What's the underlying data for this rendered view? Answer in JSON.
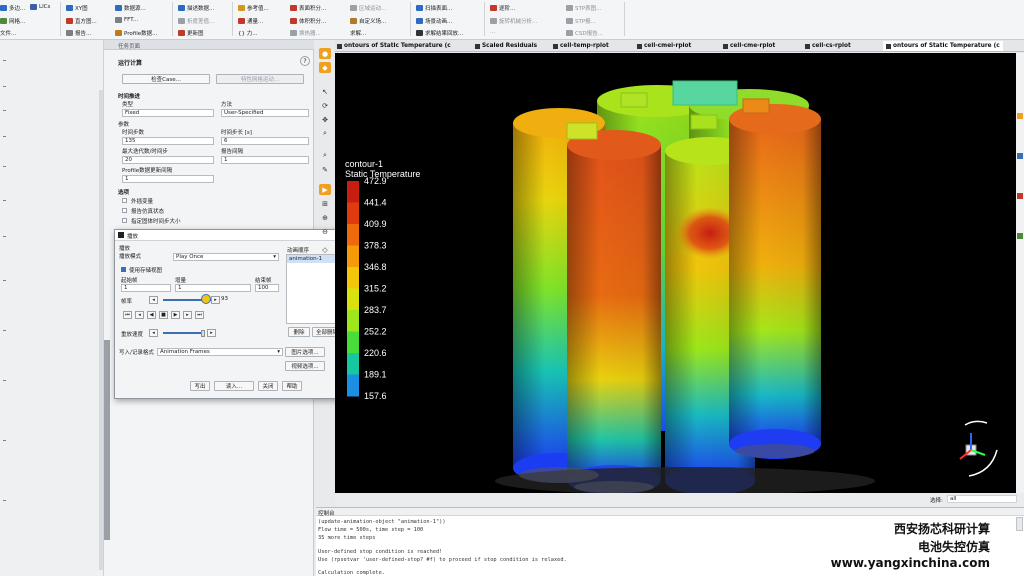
{
  "ribbon": {
    "items": [
      {
        "label": "多边...",
        "color": "#2d6cc1"
      },
      {
        "label": "网格...",
        "color": "#4f8a3a"
      },
      {
        "label": "文件...",
        "color": "#7a7f86"
      },
      {
        "label": "LICs",
        "color": "#3a5fa8"
      },
      {
        "label": "XY图",
        "color": "#2d6cc1"
      },
      {
        "label": "直方图...",
        "color": "#c0392b"
      },
      {
        "label": "报告...",
        "color": "#7a7f86"
      },
      {
        "label": "数据源...",
        "color": "#2d6cc1"
      },
      {
        "label": "FFT...",
        "color": "#7a7f86"
      },
      {
        "label": "Profile数据...",
        "color": "#c27a18"
      },
      {
        "label": "描述数据...",
        "color": "#2d6cc1"
      },
      {
        "label": "折度差值...",
        "color": "#9aa0a6"
      },
      {
        "label": "更新图",
        "color": "#c0392b"
      },
      {
        "label": "参考值...",
        "color": "#d19a1a"
      },
      {
        "label": "通量...",
        "color": "#c0392b"
      },
      {
        "label": "{} 力...",
        "color": "#2d6cc1"
      },
      {
        "label": "表面积分...",
        "color": "#c0392b"
      },
      {
        "label": "体积积分...",
        "color": "#c0392b"
      },
      {
        "label": "换热器...",
        "color": "#9aa0a6"
      },
      {
        "label": "区域运动...",
        "color": "#9aa0a6"
      },
      {
        "label": "自定义场...",
        "color": "#b07a2a"
      },
      {
        "label": "求解...",
        "color": "#7a7f86"
      },
      {
        "label": "扫描表面...",
        "color": "#2d6cc1"
      },
      {
        "label": "场景动画...",
        "color": "#2d6cc1"
      },
      {
        "label": "求解结果回放...",
        "color": "#333"
      },
      {
        "label": "逐阶...",
        "color": "#c0392b"
      },
      {
        "label": "旋转机械分析...",
        "color": "#9aa0a6"
      },
      {
        "label": "...",
        "color": "#9aa0a6"
      },
      {
        "label": "STP表图...",
        "color": "#9aa0a6"
      },
      {
        "label": "STP报...",
        "color": "#9aa0a6"
      },
      {
        "label": "CSD报告...",
        "color": "#9aa0a6"
      }
    ]
  },
  "task_panel": {
    "header": "任务页面",
    "title": "运行计算",
    "check_case": "检查Case...",
    "preview_mesh": "特性网格运动...",
    "time_advance": "时间推进",
    "type_label": "类型",
    "type_value": "Fixed",
    "method_label": "方法",
    "method_value": "User-Specified",
    "params_label": "参数",
    "num_steps_label": "时间步数",
    "num_steps_value": "135",
    "step_size_label": "时间步长 [s]",
    "step_size_value": "6",
    "max_iter_label": "最大迭代数/时间步",
    "max_iter_value": "20",
    "report_interval_label": "报告间隔",
    "report_interval_value": "1",
    "profile_label": "Profile数据更新间隔",
    "profile_value": "1",
    "options_label": "选项",
    "opt1": "外插变量",
    "opt2": "报告仿真状态",
    "opt3": "指定固体时间步大小"
  },
  "dialog": {
    "title": "播放",
    "playback": "播放",
    "mode_label": "播放模式",
    "mode_value": "Play Once",
    "use_stored_views": "使用存储视图",
    "start_label": "起始帧",
    "start_value": "1",
    "incr_label": "增量",
    "incr_value": "1",
    "end_label": "结束帧",
    "end_value": "100",
    "frame_label": "帧率",
    "frame_value": "93",
    "speed_label": "重放速度",
    "write_format_label": "写入/记录格式",
    "write_format_value": "Animation Frames",
    "seq_label": "动画顺序",
    "seq_item": "animation-1",
    "delete_btn": "删除",
    "delete_all_btn": "全部删除",
    "pic_options": "图片选项...",
    "video_options": "视频选项...",
    "write_btn": "写出",
    "read_btn": "读入...",
    "close_btn": "关闭",
    "help_btn": "帮助"
  },
  "tabs": [
    {
      "label": "ontours of Static Temperature (c"
    },
    {
      "label": "Scaled Residuals"
    },
    {
      "label": "cell-temp-rplot"
    },
    {
      "label": "cell-cmei-rplot"
    },
    {
      "label": "cell-cme-rplot"
    },
    {
      "label": "cell-cs-rplot"
    },
    {
      "label": "ontours of Static Temperature (c"
    }
  ],
  "contour": {
    "name": "contour-1",
    "variable": "Static Temperature",
    "levels": [
      "472.9",
      "441.4",
      "409.9",
      "378.3",
      "346.8",
      "315.2",
      "283.7",
      "252.2",
      "220.6",
      "189.1",
      "157.6"
    ],
    "colors": [
      "#c81e12",
      "#e03a10",
      "#ef6a0c",
      "#f59b0a",
      "#f2c60b",
      "#d9e20f",
      "#9ee71a",
      "#49dd3a",
      "#16c8a0",
      "#1b8fe4",
      "#1e3cf2"
    ]
  },
  "select_bar": {
    "label": "选择:",
    "value": "all"
  },
  "console": {
    "title": "控制台",
    "lines": [
      "(update-animation-object \"animation-1\"))",
      "Flow time = 500s, time step = 100",
      "35 more time steps",
      "",
      "User-defined stop condition is reached!",
      "Use (rpsetvar 'user-defined-stop? #f) to proceed if stop condition is relaxed.",
      "",
      "Calculation complete."
    ]
  },
  "watermark": {
    "line1": "西安扬芯科研计算",
    "line2": "电池失控仿真",
    "line3": "www.yangxinchina.com"
  }
}
